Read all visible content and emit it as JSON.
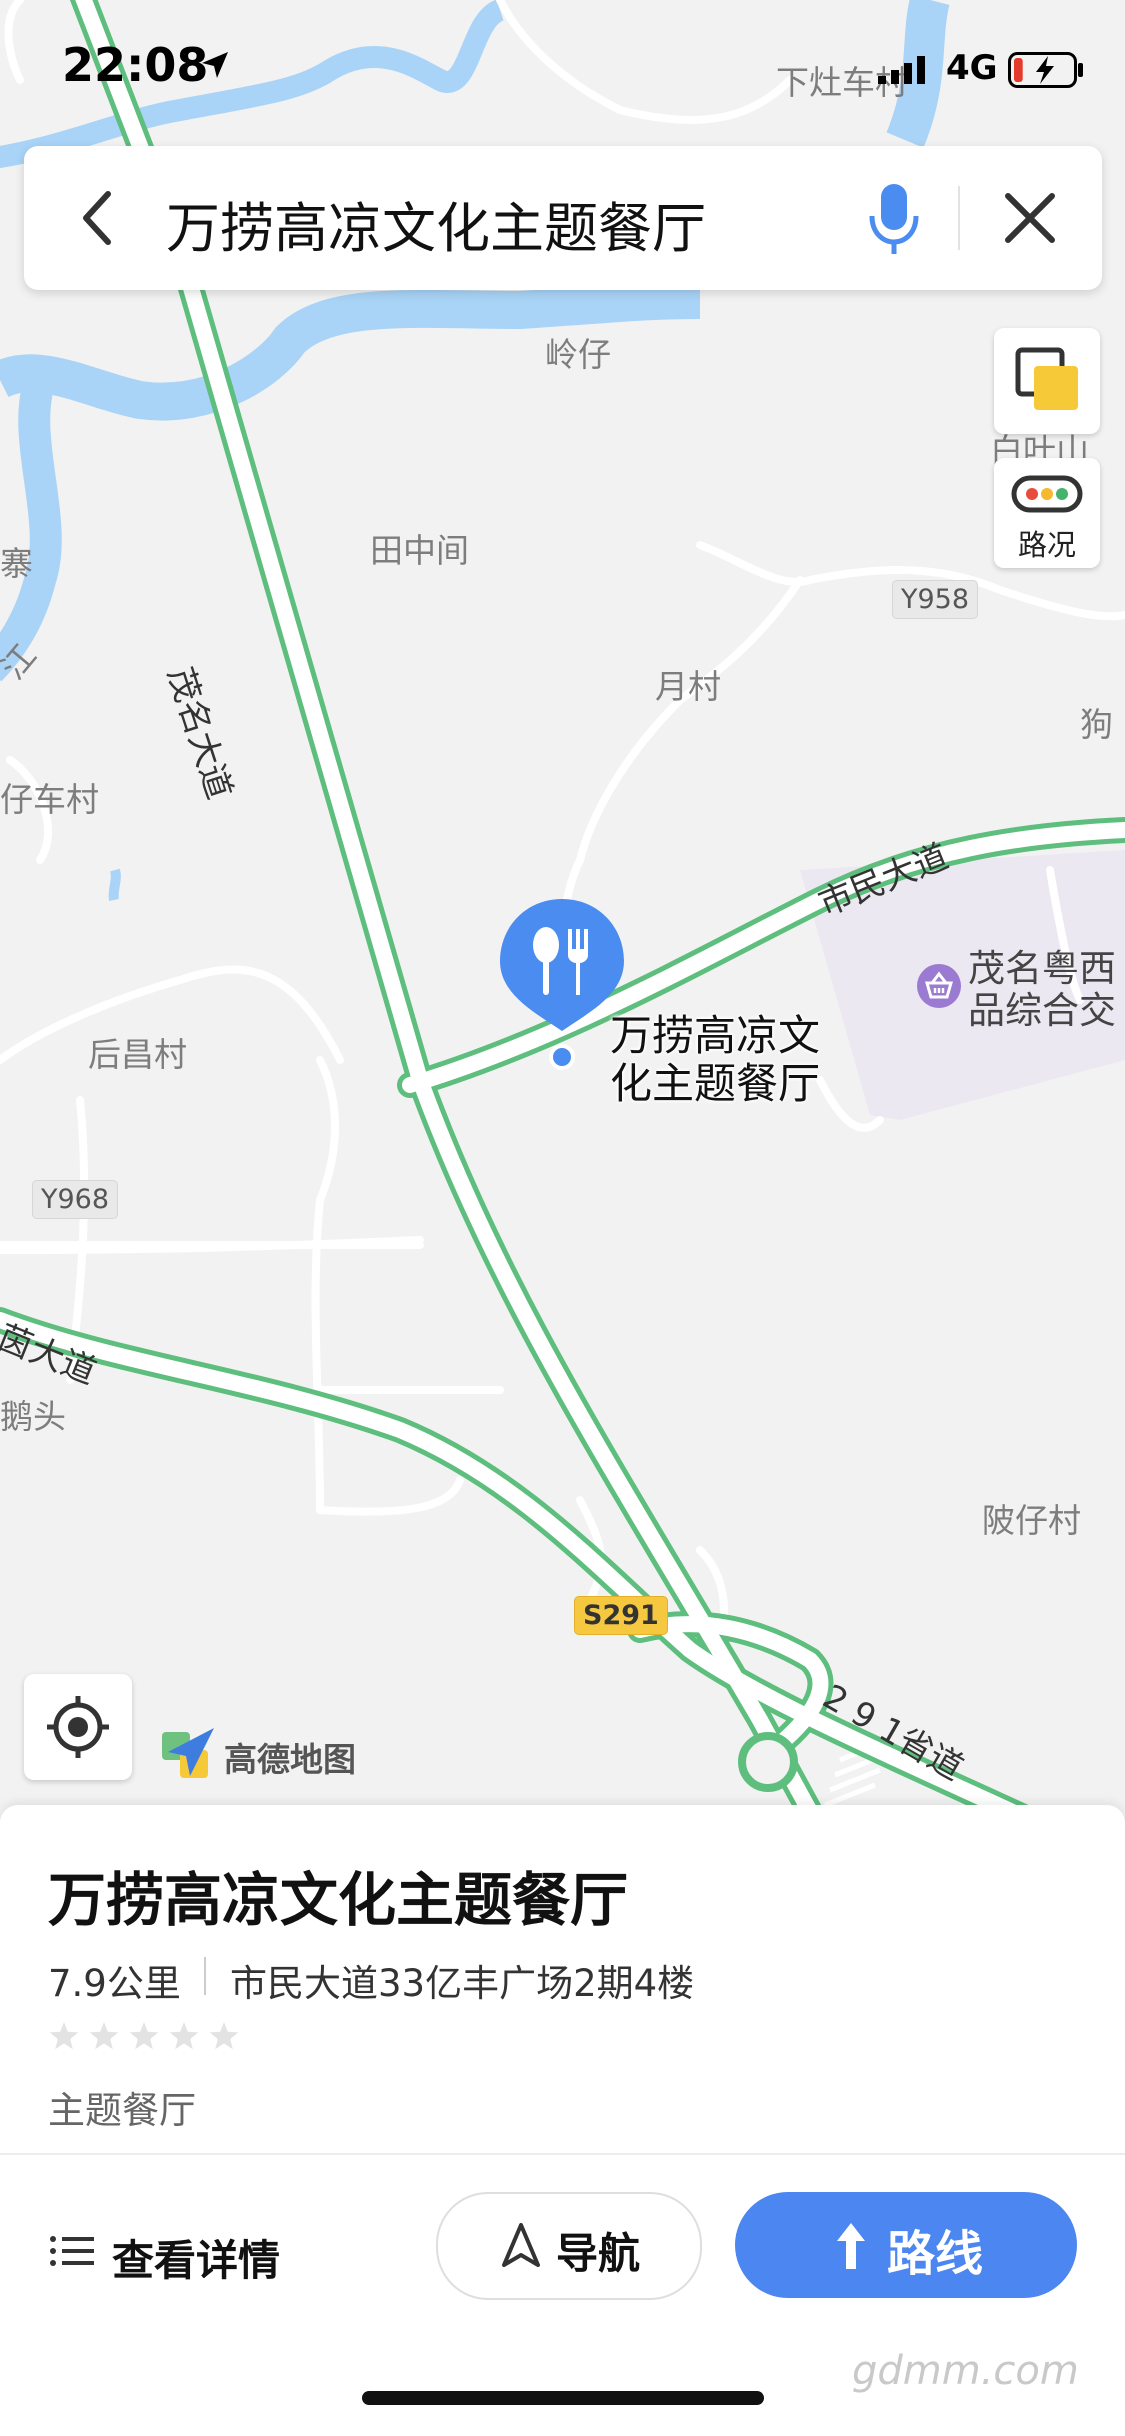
{
  "status_bar": {
    "time": "22:08",
    "network": "4G",
    "battery_level": 0.15
  },
  "search": {
    "query": "万捞高凉文化主题餐厅"
  },
  "map": {
    "place_labels": {
      "xiazaochecun": "下灶车村",
      "lingzai": "岭仔",
      "baiyeshan": "白叶山",
      "tianzhongjian": "田中间",
      "yuecun": "月村",
      "gouzi": "狗",
      "zaichecun": "仔车村",
      "houchangcun": "后昌村",
      "hetou": "鹅头",
      "pizaicun": "陂仔村",
      "zhai": "寨",
      "jiang": "江"
    },
    "road_labels": {
      "maoming_avenue": "茂名大道",
      "shimin_avenue": "市民大道",
      "yin_avenue": "茵大道",
      "provincial_road": "2 9 1省道"
    },
    "road_badges": {
      "y958": "Y958",
      "y968": "Y968",
      "s291": "S291"
    },
    "traffic_button_label": "路况",
    "poi_label_line1": "万捞高凉文",
    "poi_label_line2": "化主题餐厅",
    "mall_label_line1": "茂名粤西",
    "mall_label_line2": "品综合交",
    "brand_name": "高德地图",
    "colors": {
      "road_green": "#5dbe7d",
      "river_blue": "#a9d4f7",
      "pin_blue": "#4a8cf0",
      "mall_area": "#ece8f1",
      "mall_icon": "#9b7ad1"
    }
  },
  "poi": {
    "name": "万捞高凉文化主题餐厅",
    "distance": "7.9公里",
    "address": "市民大道33亿丰广场2期4楼",
    "rating_stars": 0,
    "rating_max": 5,
    "category": "主题餐厅"
  },
  "actions": {
    "details_label": "查看详情",
    "navigate_label": "导航",
    "route_label": "路线"
  },
  "watermark": "gdmm.com"
}
